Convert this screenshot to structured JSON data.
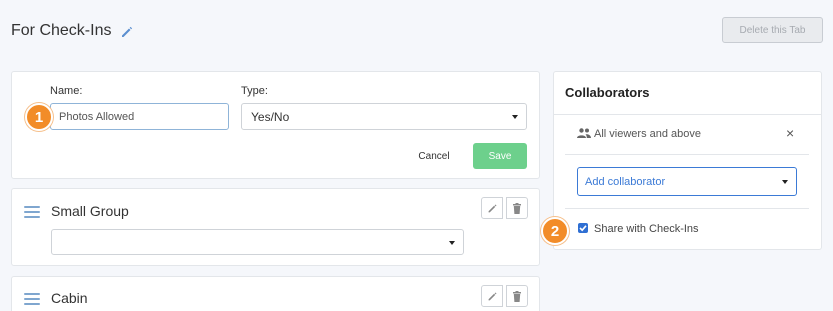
{
  "header": {
    "title": "For Check-Ins",
    "delete_tab_label": "Delete this Tab"
  },
  "edit_form": {
    "name_label": "Name:",
    "name_value": "Photos Allowed",
    "type_label": "Type:",
    "type_value": "Yes/No",
    "cancel_label": "Cancel",
    "save_label": "Save"
  },
  "fields": [
    {
      "title": "Small Group",
      "select_value": ""
    },
    {
      "title": "Cabin"
    }
  ],
  "collaborators": {
    "title": "Collaborators",
    "viewers_label": "All viewers and above",
    "close_symbol": "×",
    "add_placeholder": "Add collaborator",
    "share_label": "Share with Check-Ins",
    "share_checked": true
  },
  "step_badges": [
    "1",
    "2"
  ],
  "colors": {
    "accent_blue": "#3b7ad6",
    "save_green": "#6dd08c",
    "badge_orange": "#f28c28",
    "background": "#f5f7fb"
  },
  "icons": {
    "title_edit": "pencil-icon",
    "drag": "drag-handle-icon",
    "edit": "pencil-icon",
    "delete": "trash-icon",
    "people": "people-icon",
    "close": "close-icon",
    "dropdown": "chevron-down-icon",
    "check": "check-icon"
  }
}
